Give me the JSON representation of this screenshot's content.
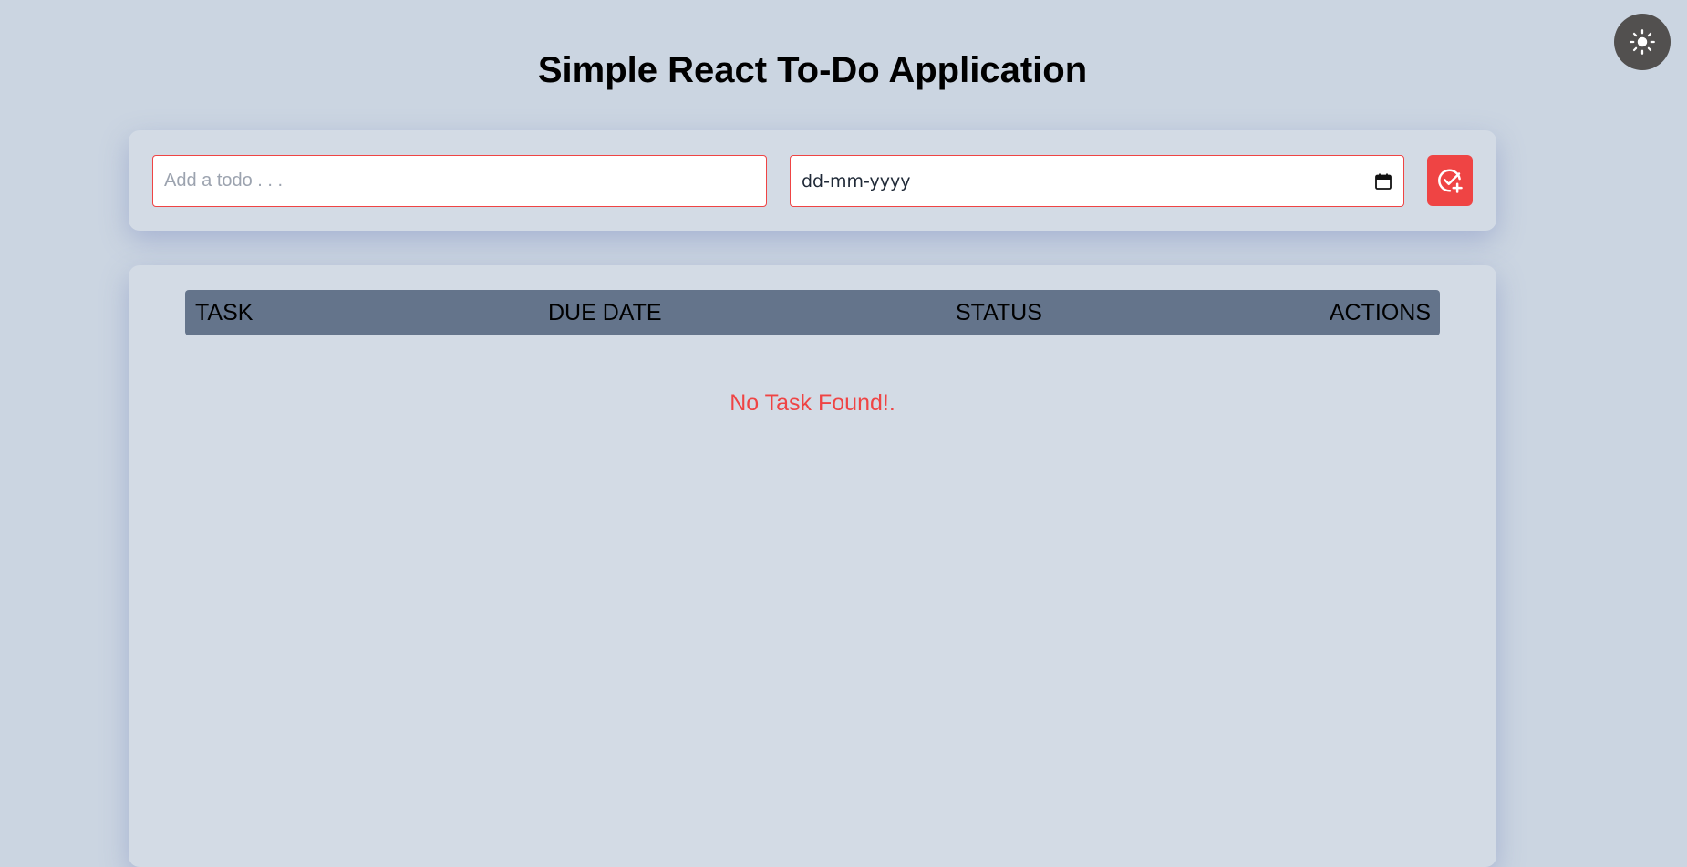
{
  "app": {
    "title": "Simple React To-Do Application"
  },
  "theme_toggle": {
    "icon": "sun-icon",
    "icon_color": "#ffffff",
    "background": "#52504f"
  },
  "form": {
    "todo_placeholder": "Add a todo . . .",
    "date_value": "dd-mm-yyyy",
    "date_icon": "calendar-icon",
    "add_icon": "check-circle-plus-icon",
    "accent_color": "#ef4444"
  },
  "table": {
    "columns": [
      "TASK",
      "DUE DATE",
      "STATUS",
      "ACTIONS"
    ],
    "header_background": "#64748b",
    "empty_message": "No Task Found!."
  }
}
